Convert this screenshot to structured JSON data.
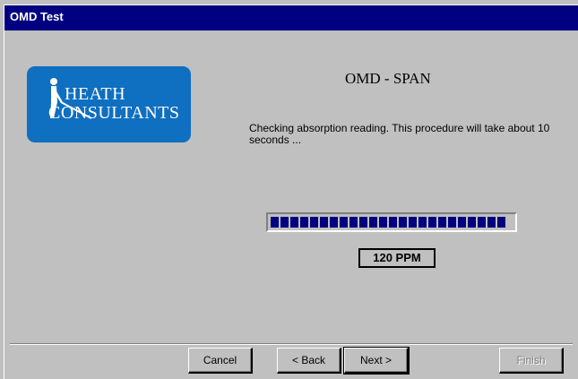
{
  "window": {
    "title": "OMD Test"
  },
  "logo": {
    "line1": "HEATH",
    "line2": "CONSULTANTS"
  },
  "main": {
    "heading": "OMD - SPAN",
    "message": "Checking absorption reading. This procedure will take about 10 seconds ...",
    "progress": {
      "value": 0.97
    },
    "reading": "120 PPM"
  },
  "buttons": {
    "cancel": "Cancel",
    "back": "< Back",
    "next": "Next >",
    "finish": "Finish"
  },
  "colors": {
    "titlebar": "#000080",
    "window_bg": "#c0c0c0",
    "logo_bg": "#0f6fc0",
    "progress_fill": "#000080"
  }
}
